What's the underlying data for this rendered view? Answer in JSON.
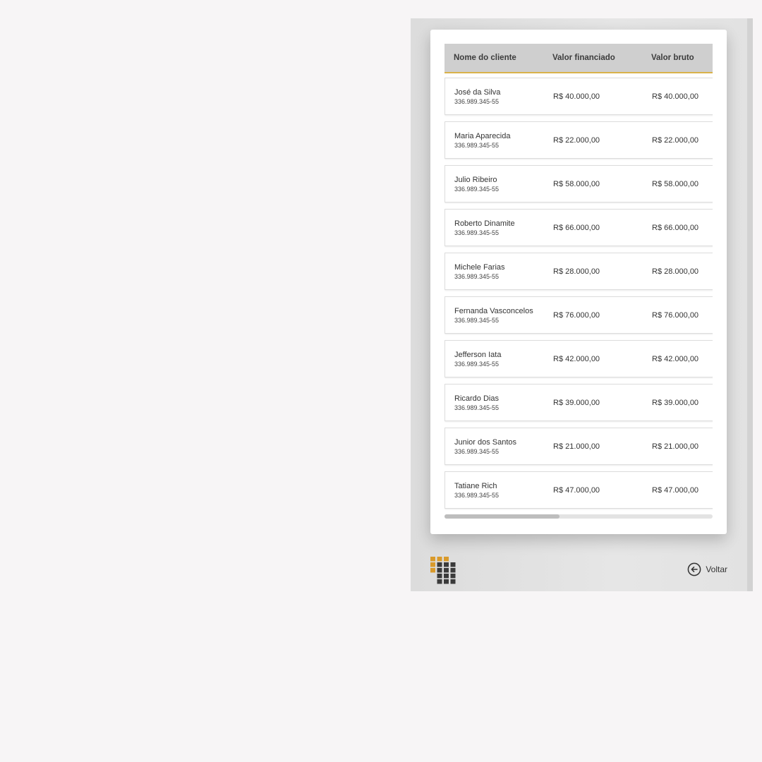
{
  "table": {
    "headers": [
      "Nome do cliente",
      "Valor financiado",
      "Valor bruto"
    ],
    "rows": [
      {
        "name": "José da Silva",
        "cpf": "336.989.345-55",
        "financed": "R$ 40.000,00",
        "gross": "R$ 40.000,00"
      },
      {
        "name": "Maria Aparecida",
        "cpf": "336.989.345-55",
        "financed": "R$ 22.000,00",
        "gross": "R$ 22.000,00"
      },
      {
        "name": "Julio Ribeiro",
        "cpf": "336.989.345-55",
        "financed": "R$ 58.000,00",
        "gross": "R$ 58.000,00"
      },
      {
        "name": "Roberto Dinamite",
        "cpf": "336.989.345-55",
        "financed": "R$ 66.000,00",
        "gross": "R$ 66.000,00"
      },
      {
        "name": "Michele Farias",
        "cpf": "336.989.345-55",
        "financed": "R$ 28.000,00",
        "gross": "R$ 28.000,00"
      },
      {
        "name": "Fernanda Vasconcelos",
        "cpf": "336.989.345-55",
        "financed": "R$ 76.000,00",
        "gross": "R$ 76.000,00"
      },
      {
        "name": "Jefferson Iata",
        "cpf": "336.989.345-55",
        "financed": "R$ 42.000,00",
        "gross": "R$ 42.000,00"
      },
      {
        "name": "Ricardo Dias",
        "cpf": "336.989.345-55",
        "financed": "R$ 39.000,00",
        "gross": "R$ 39.000,00"
      },
      {
        "name": "Junior dos Santos",
        "cpf": "336.989.345-55",
        "financed": "R$ 21.000,00",
        "gross": "R$ 21.000,00"
      },
      {
        "name": "Tatiane Rich",
        "cpf": "336.989.345-55",
        "financed": "R$ 47.000,00",
        "gross": "R$ 47.000,00"
      }
    ],
    "scroll_position": 0.43
  },
  "footer": {
    "back_label": "Voltar",
    "back_icon": "arrow-left-circle-icon",
    "logo_icon": "dot-grid-logo"
  },
  "colors": {
    "accent": "#d9b24a",
    "logo_gold": "#d99a2b",
    "logo_dark": "#3b3b3b"
  }
}
